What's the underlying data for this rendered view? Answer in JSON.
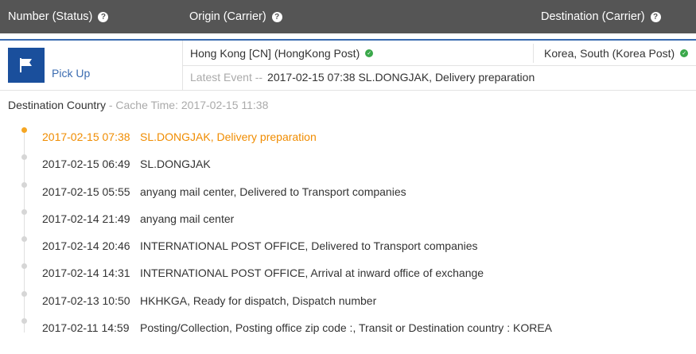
{
  "header": {
    "number_label": "Number (Status)",
    "origin_label": "Origin (Carrier)",
    "destination_label": "Destination (Carrier)"
  },
  "shipment": {
    "status": "Pick Up",
    "origin": "Hong Kong [CN] (HongKong Post)",
    "destination": "Korea, South (Korea Post)",
    "latest_label": "Latest Event --",
    "latest_event": "2017-02-15 07:38 SL.DONGJAK, Delivery preparation"
  },
  "section": {
    "title": "Destination Country",
    "cache": " - Cache Time: 2017-02-15 11:38"
  },
  "events": [
    {
      "time": "2017-02-15 07:38",
      "desc": "SL.DONGJAK, Delivery preparation"
    },
    {
      "time": "2017-02-15 06:49",
      "desc": "SL.DONGJAK"
    },
    {
      "time": "2017-02-15 05:55",
      "desc": "anyang mail center, Delivered to Transport companies"
    },
    {
      "time": "2017-02-14 21:49",
      "desc": "anyang mail center"
    },
    {
      "time": "2017-02-14 20:46",
      "desc": "INTERNATIONAL POST OFFICE, Delivered to Transport companies"
    },
    {
      "time": "2017-02-14 14:31",
      "desc": "INTERNATIONAL POST OFFICE, Arrival at inward office of exchange"
    },
    {
      "time": "2017-02-13 10:50",
      "desc": "HKHKGA, Ready for dispatch, Dispatch number"
    },
    {
      "time": "2017-02-11 14:59",
      "desc": "Posting/Collection, Posting office zip code :, Transit or Destination country : KOREA"
    }
  ],
  "colors": {
    "header_bg": "#555555",
    "accent_blue": "#1a4f9c",
    "latest_orange": "#f08c00",
    "check_green": "#3aa84a"
  }
}
